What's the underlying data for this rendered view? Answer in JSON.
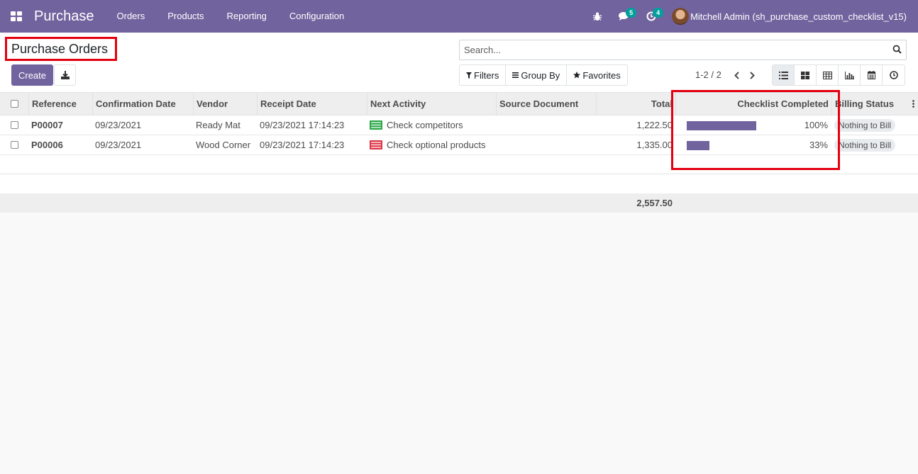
{
  "navbar": {
    "app_name": "Purchase",
    "menu": [
      "Orders",
      "Products",
      "Reporting",
      "Configuration"
    ],
    "messages_count": "5",
    "activities_count": "4",
    "user": "Mitchell Admin (sh_purchase_custom_checklist_v15)",
    "bg_color": "#71639e"
  },
  "control_panel": {
    "title": "Purchase Orders",
    "create_label": "Create",
    "search_placeholder": "Search...",
    "filters_label": "Filters",
    "group_by_label": "Group By",
    "favorites_label": "Favorites",
    "pager": "1-2 / 2"
  },
  "table": {
    "headers": [
      "Reference",
      "Confirmation Date",
      "Vendor",
      "Receipt Date",
      "Next Activity",
      "Source Document",
      "Total",
      "Checklist Completed",
      "Billing Status"
    ],
    "rows": [
      {
        "reference": "P00007",
        "confirmation_date": "09/23/2021",
        "vendor": "Ready Mat",
        "receipt_date": "09/23/2021 17:14:23",
        "activity_icon": "activity-green-icon",
        "next_activity": "Check competitors",
        "source_document": "",
        "total": "1,222.50",
        "checklist_pct": "100%",
        "checklist_fraction": 1.0,
        "billing_status": "Nothing to Bill"
      },
      {
        "reference": "P00006",
        "confirmation_date": "09/23/2021",
        "vendor": "Wood Corner",
        "receipt_date": "09/23/2021 17:14:23",
        "activity_icon": "activity-red-icon",
        "next_activity": "Check optional products",
        "source_document": "",
        "total": "1,335.00",
        "checklist_pct": "33%",
        "checklist_fraction": 0.33,
        "billing_status": "Nothing to Bill"
      }
    ],
    "footer_total": "2,557.50"
  }
}
